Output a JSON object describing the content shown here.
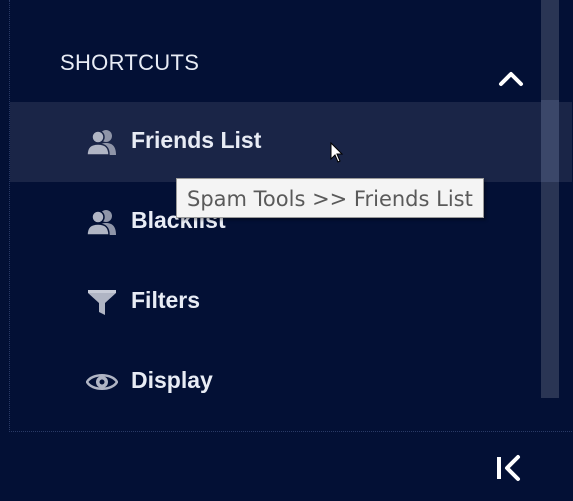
{
  "sidebar": {
    "section_title": "SHORTCUTS",
    "collapse_icon": "chevron-up-icon",
    "items": [
      {
        "label": "Friends List",
        "icon": "friends-icon",
        "active": true
      },
      {
        "label": "Blacklist",
        "icon": "blacklist-icon",
        "active": false
      },
      {
        "label": "Filters",
        "icon": "funnel-icon",
        "active": false
      },
      {
        "label": "Display",
        "icon": "eye-icon",
        "active": false
      }
    ],
    "bottom_icon": "collapse-left-icon"
  },
  "tooltip": {
    "text": "Spam Tools >> Friends List"
  },
  "colors": {
    "background": "#031035",
    "active_row": "#1a2547",
    "text": "#e8ecf5",
    "icon": "#9aa0b2"
  }
}
